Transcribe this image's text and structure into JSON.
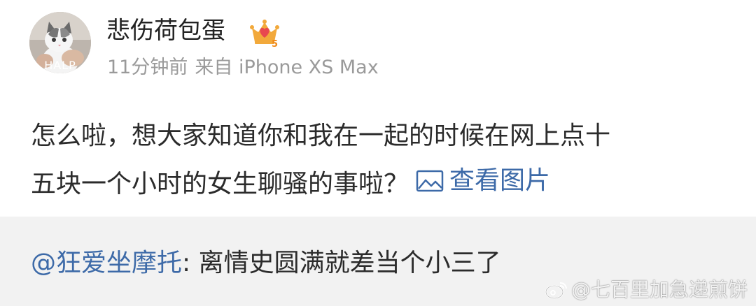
{
  "post": {
    "author": {
      "name": "悲伤荷包蛋",
      "avatar_text": "HALP",
      "vip_level": "5"
    },
    "meta": {
      "time": "11分钟前",
      "source": "来自 iPhone XS Max"
    },
    "content": {
      "line1": "怎么啦，想大家知道你和我在一起的时候在网上点十",
      "line2": "五块一个小时的女生聊骚的事啦？",
      "view_picture_label": "查看图片"
    }
  },
  "comment": {
    "user": "@狂爱坐摩托",
    "separator": ": ",
    "text": "离情史圆满就差当个小三了"
  },
  "watermark": {
    "text": "@七百里加急递煎饼"
  },
  "colors": {
    "link": "#3d6aa8",
    "text": "#2b2b2b",
    "meta": "#9a9a9a",
    "comment_bg": "#f2f2f2",
    "badge_gold": "#f2a93b",
    "badge_pink": "#e8484f"
  }
}
